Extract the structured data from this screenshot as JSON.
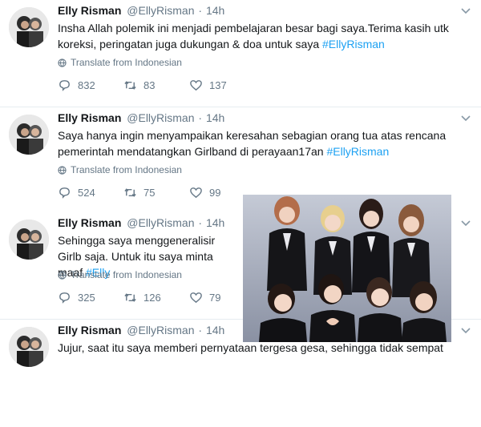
{
  "tweets": [
    {
      "name": "Elly Risman",
      "handle": "@EllyRisman",
      "time": "14h",
      "text": "Insha Allah polemik ini menjadi pembelajaran besar bagi saya.Terima kasih utk koreksi, peringatan juga dukungan & doa untuk saya ",
      "hashtag": "#EllyRisman",
      "translate": "Translate from Indonesian",
      "replies": "832",
      "retweets": "83",
      "likes": "137"
    },
    {
      "name": "Elly Risman",
      "handle": "@EllyRisman",
      "time": "14h",
      "text": "Saya hanya ingin menyampaikan keresahan sebagian orang tua atas rencana pemerintah mendatangkan Girlband di perayaan17an ",
      "hashtag": "#EllyRisman",
      "translate": "Translate from Indonesian",
      "replies": "524",
      "retweets": "75",
      "likes": "99"
    },
    {
      "name": "Elly Risman",
      "handle": "@EllyRisman",
      "time": "14h",
      "text": "Sehingga saya menggeneralisir Girlb saja. Untuk itu saya minta maaf ",
      "hashtag": "#Elly",
      "translate": "Translate from Indonesian",
      "replies": "325",
      "retweets": "126",
      "likes": "79"
    },
    {
      "name": "Elly Risman",
      "handle": "@EllyRisman",
      "time": "14h",
      "text": "Jujur, saat itu saya memberi pernyataan  tergesa gesa, sehingga tidak sempat"
    }
  ],
  "icons": {
    "reply": "reply-icon",
    "retweet": "retweet-icon",
    "like": "heart-icon",
    "translate": "globe-icon",
    "menu": "chevron-down-icon"
  },
  "colors": {
    "hashtag": "#1da1f2",
    "secondary_text": "#657786",
    "divider": "#e6ecf0"
  }
}
